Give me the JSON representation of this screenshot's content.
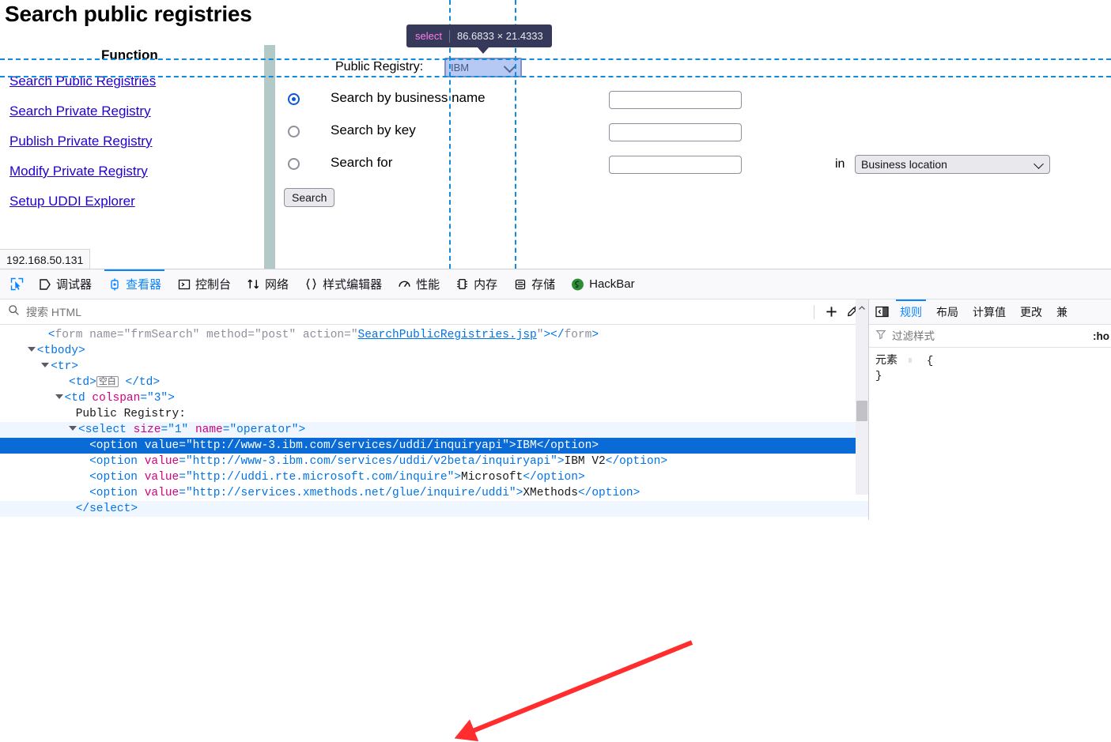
{
  "page": {
    "title": "Search public registries",
    "function_header": "Function",
    "nav_links": [
      "Search Public Registries",
      "Search Private Registry",
      "Publish Private Registry",
      "Modify Private Registry",
      "Setup UDDI Explorer"
    ],
    "registry_label": "Public Registry:",
    "registry_value": "IBM",
    "registry_options": [
      "IBM",
      "IBM V2",
      "Microsoft",
      "XMethods"
    ],
    "radios": [
      {
        "label": "Search by business name",
        "checked": true
      },
      {
        "label": "Search by key",
        "checked": false
      },
      {
        "label": "Search for",
        "checked": false
      }
    ],
    "text_inputs": [
      "",
      "",
      ""
    ],
    "in_label": "in",
    "location_value": "Business location",
    "search_button": "Search",
    "status_bar": "192.168.50.131"
  },
  "infobar": {
    "tag": "select",
    "dimensions": "86.6833 × 21.4333"
  },
  "devtools": {
    "tabs": [
      {
        "label": "调试器",
        "icon": "debugger-icon",
        "active": false
      },
      {
        "label": "查看器",
        "icon": "inspector-icon",
        "active": true
      },
      {
        "label": "控制台",
        "icon": "console-icon",
        "active": false
      },
      {
        "label": "网络",
        "icon": "network-icon",
        "active": false
      },
      {
        "label": "样式编辑器",
        "icon": "style-editor-icon",
        "active": false
      },
      {
        "label": "性能",
        "icon": "performance-icon",
        "active": false
      },
      {
        "label": "内存",
        "icon": "memory-icon",
        "active": false
      },
      {
        "label": "存储",
        "icon": "storage-icon",
        "active": false
      },
      {
        "label": "HackBar",
        "icon": "hackbar-icon",
        "active": false
      }
    ],
    "search_html_placeholder": "搜索 HTML",
    "search_html_value": "",
    "markup": [
      {
        "indent": 7,
        "twisty": false,
        "state": "normal",
        "tokens": [
          {
            "t": "punct",
            "v": "<"
          },
          {
            "t": "grayattr",
            "v": "form"
          },
          {
            "t": "grayattr",
            "v": " name"
          },
          {
            "t": "grayattr",
            "v": "="
          },
          {
            "t": "grayattr",
            "v": "\"frmSearch\""
          },
          {
            "t": "grayattr",
            "v": " method"
          },
          {
            "t": "grayattr",
            "v": "="
          },
          {
            "t": "grayattr",
            "v": "\"post\""
          },
          {
            "t": "grayattr",
            "v": " action"
          },
          {
            "t": "grayattr",
            "v": "="
          },
          {
            "t": "grayattr",
            "v": "\""
          },
          {
            "t": "link",
            "v": "SearchPublicRegistries.jsp"
          },
          {
            "t": "grayattr",
            "v": "\""
          },
          {
            "t": "punct",
            "v": "></"
          },
          {
            "t": "grayattr",
            "v": "form"
          },
          {
            "t": "punct",
            "v": ">"
          }
        ]
      },
      {
        "indent": 4,
        "twisty": true,
        "state": "normal",
        "tokens": [
          {
            "t": "punct",
            "v": "<"
          },
          {
            "t": "tag",
            "v": "tbody"
          },
          {
            "t": "punct",
            "v": ">"
          }
        ]
      },
      {
        "indent": 6,
        "twisty": true,
        "state": "normal",
        "tokens": [
          {
            "t": "punct",
            "v": "<"
          },
          {
            "t": "tag",
            "v": "tr"
          },
          {
            "t": "punct",
            "v": ">"
          }
        ]
      },
      {
        "indent": 10,
        "twisty": false,
        "state": "normal",
        "tokens": [
          {
            "t": "punct",
            "v": "<"
          },
          {
            "t": "tag",
            "v": "td"
          },
          {
            "t": "punct",
            "v": ">"
          },
          {
            "t": "badge",
            "v": "空白"
          },
          {
            "t": "text",
            "v": " "
          },
          {
            "t": "punct",
            "v": "</"
          },
          {
            "t": "tag",
            "v": "td"
          },
          {
            "t": "punct",
            "v": ">"
          }
        ]
      },
      {
        "indent": 8,
        "twisty": true,
        "state": "normal",
        "tokens": [
          {
            "t": "punct",
            "v": "<"
          },
          {
            "t": "tag",
            "v": "td"
          },
          {
            "t": "attr",
            "v": " colspan"
          },
          {
            "t": "punct",
            "v": "="
          },
          {
            "t": "val",
            "v": "\"3\""
          },
          {
            "t": "punct",
            "v": ">"
          }
        ]
      },
      {
        "indent": 11,
        "twisty": false,
        "state": "normal",
        "tokens": [
          {
            "t": "text",
            "v": "Public Registry:"
          }
        ]
      },
      {
        "indent": 10,
        "twisty": true,
        "state": "sel-parent",
        "tokens": [
          {
            "t": "punct",
            "v": "<"
          },
          {
            "t": "tag",
            "v": "select"
          },
          {
            "t": "attr",
            "v": " size"
          },
          {
            "t": "punct",
            "v": "="
          },
          {
            "t": "val",
            "v": "\"1\""
          },
          {
            "t": "attr",
            "v": " name"
          },
          {
            "t": "punct",
            "v": "="
          },
          {
            "t": "val",
            "v": "\"operator\""
          },
          {
            "t": "punct",
            "v": ">"
          }
        ]
      },
      {
        "indent": 13,
        "twisty": false,
        "state": "selected",
        "tokens": [
          {
            "t": "punct",
            "v": "<"
          },
          {
            "t": "tag",
            "v": "option"
          },
          {
            "t": "attr",
            "v": " value"
          },
          {
            "t": "punct",
            "v": "="
          },
          {
            "t": "val",
            "v": "\"http://www-3.ibm.com/services/uddi/inquiryapi\""
          },
          {
            "t": "punct",
            "v": ">"
          },
          {
            "t": "text",
            "v": "IBM"
          },
          {
            "t": "punct",
            "v": "</"
          },
          {
            "t": "tag",
            "v": "option"
          },
          {
            "t": "punct",
            "v": ">"
          }
        ]
      },
      {
        "indent": 13,
        "twisty": false,
        "state": "normal",
        "tokens": [
          {
            "t": "punct",
            "v": "<"
          },
          {
            "t": "tag",
            "v": "option"
          },
          {
            "t": "attr",
            "v": " value"
          },
          {
            "t": "punct",
            "v": "="
          },
          {
            "t": "val",
            "v": "\"http://www-3.ibm.com/services/uddi/v2beta/inquiryapi\""
          },
          {
            "t": "punct",
            "v": ">"
          },
          {
            "t": "text",
            "v": "IBM V2"
          },
          {
            "t": "punct",
            "v": "</"
          },
          {
            "t": "tag",
            "v": "option"
          },
          {
            "t": "punct",
            "v": ">"
          }
        ]
      },
      {
        "indent": 13,
        "twisty": false,
        "state": "normal",
        "tokens": [
          {
            "t": "punct",
            "v": "<"
          },
          {
            "t": "tag",
            "v": "option"
          },
          {
            "t": "attr",
            "v": " value"
          },
          {
            "t": "punct",
            "v": "="
          },
          {
            "t": "val",
            "v": "\"http://uddi.rte.microsoft.com/inquire\""
          },
          {
            "t": "punct",
            "v": ">"
          },
          {
            "t": "text",
            "v": "Microsoft"
          },
          {
            "t": "punct",
            "v": "</"
          },
          {
            "t": "tag",
            "v": "option"
          },
          {
            "t": "punct",
            "v": ">"
          }
        ]
      },
      {
        "indent": 13,
        "twisty": false,
        "state": "normal",
        "tokens": [
          {
            "t": "punct",
            "v": "<"
          },
          {
            "t": "tag",
            "v": "option"
          },
          {
            "t": "attr",
            "v": " value"
          },
          {
            "t": "punct",
            "v": "="
          },
          {
            "t": "val",
            "v": "\"http://services.xmethods.net/glue/inquire/uddi\""
          },
          {
            "t": "punct",
            "v": ">"
          },
          {
            "t": "text",
            "v": "XMethods"
          },
          {
            "t": "punct",
            "v": "</"
          },
          {
            "t": "tag",
            "v": "option"
          },
          {
            "t": "punct",
            "v": ">"
          }
        ]
      },
      {
        "indent": 11,
        "twisty": false,
        "state": "sel-parent",
        "tokens": [
          {
            "t": "punct",
            "v": "</"
          },
          {
            "t": "tag",
            "v": "select"
          },
          {
            "t": "punct",
            "v": ">"
          }
        ]
      }
    ],
    "rules_tabs": [
      {
        "label": "规则",
        "active": true
      },
      {
        "label": "布局",
        "active": false
      },
      {
        "label": "计算值",
        "active": false
      },
      {
        "label": "更改",
        "active": false
      },
      {
        "label": "兼",
        "active": false
      }
    ],
    "filter_placeholder": "过滤样式",
    "filter_value": "",
    "hover_toggle": ":ho",
    "rules_element_label": "元素",
    "rules_open_brace": "{",
    "rules_close_brace": "}"
  },
  "colors": {
    "accent": "#0a84ff",
    "selected_row": "#0a6bd6",
    "guide_line": "#0f8cdb",
    "infobar_bg": "#363959",
    "infobar_tag": "#ff7de9",
    "link": "#2200cc",
    "arrow": "#ff2d2d"
  }
}
